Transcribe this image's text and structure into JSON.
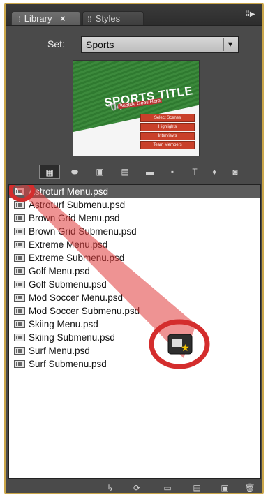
{
  "tabs": [
    {
      "label": "Library",
      "active": true,
      "close": "×"
    },
    {
      "label": "Styles",
      "active": false
    }
  ],
  "set": {
    "label": "Set:",
    "value": "Sports"
  },
  "thumbnail": {
    "title": "SPORTS TITLE",
    "year": "'04",
    "subtitle": "Subtitle Goes Here",
    "buttons": [
      "Select Scenes",
      "Highlights",
      "Interviews",
      "Team Members"
    ]
  },
  "toolbar": [
    {
      "name": "menu-filter-icon",
      "glyph": "▦"
    },
    {
      "name": "button-filter-icon",
      "glyph": "⬬"
    },
    {
      "name": "image-filter-icon",
      "glyph": "▣"
    },
    {
      "name": "background-filter-icon",
      "glyph": "▤"
    },
    {
      "name": "folder-filter-icon",
      "glyph": "▬"
    },
    {
      "name": "layout-filter-icon",
      "glyph": "▪"
    },
    {
      "name": "text-filter-icon",
      "glyph": "T"
    },
    {
      "name": "drop-filter-icon",
      "glyph": "♦"
    },
    {
      "name": "transition-filter-icon",
      "glyph": "◙"
    }
  ],
  "files": [
    "Astroturf Menu.psd",
    "Astroturf Submenu.psd",
    "Brown Grid Menu.psd",
    "Brown Grid Submenu.psd",
    "Extreme Menu.psd",
    "Extreme Submenu.psd",
    "Golf Menu.psd",
    "Golf Submenu.psd",
    "Mod Soccer Menu.psd",
    "Mod Soccer Submenu.psd",
    "Skiing Menu.psd",
    "Skiing Submenu.psd",
    "Surf Menu.psd",
    "Surf Submenu.psd"
  ],
  "selected_index": 0,
  "colors": {
    "panel_bg": "#4a4a4a",
    "panel_border": "#caa64a",
    "selection": "#5c5c5c",
    "highlight_red": "#d42d2d"
  },
  "bottom_bar": [
    {
      "name": "place-icon",
      "glyph": "↳"
    },
    {
      "name": "link-icon",
      "glyph": "⟳"
    },
    {
      "name": "new-item-icon",
      "glyph": "▭"
    },
    {
      "name": "set-default-menu-icon",
      "glyph": "▤"
    },
    {
      "name": "new-icon",
      "glyph": "▣"
    },
    {
      "name": "delete-icon",
      "glyph": "🗑"
    }
  ]
}
